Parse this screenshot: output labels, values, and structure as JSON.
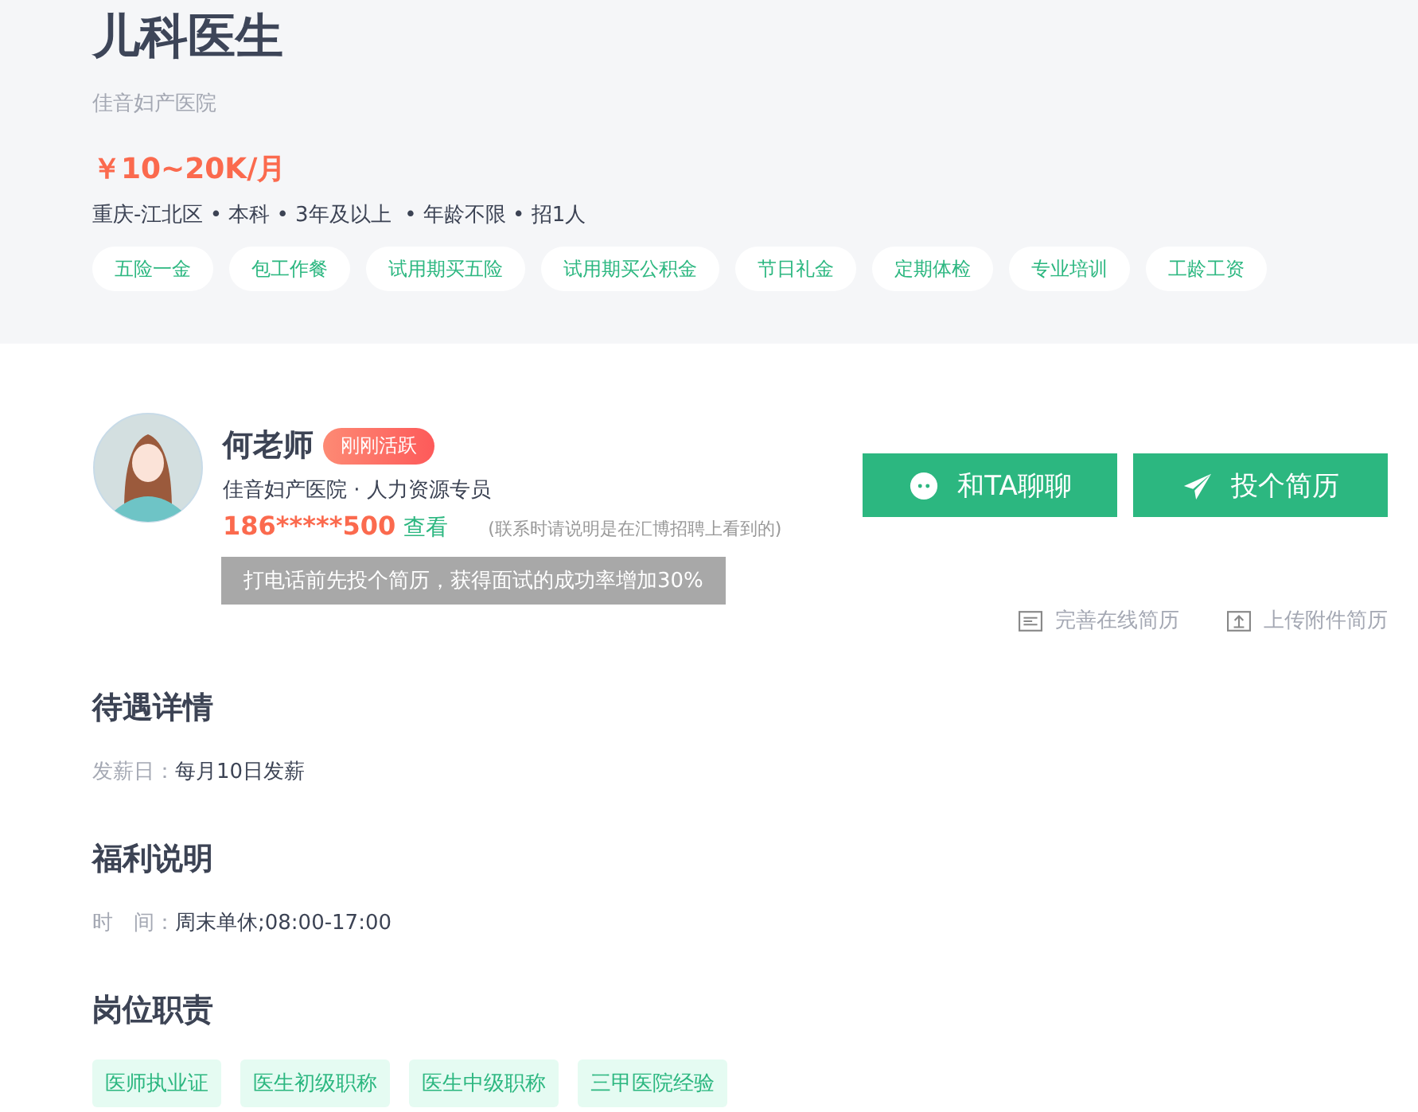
{
  "job": {
    "title": "儿科医生",
    "company": "佳音妇产医院",
    "salary": "￥10~20K/月",
    "meta": "重庆-江北区 • 本科 • 3年及以上  • 年龄不限 • 招1人",
    "benefits": [
      "五险一金",
      "包工作餐",
      "试用期买五险",
      "试用期买公积金",
      "节日礼金",
      "定期体检",
      "专业培训",
      "工龄工资"
    ]
  },
  "recruiter": {
    "name": "何老师",
    "status": "刚刚活跃",
    "org": "佳音妇产医院 · 人力资源专员",
    "phone": "186*****500",
    "view_link": "查看",
    "note": "(联系时请说明是在汇博招聘上看到的)",
    "tooltip": "打电话前先投个简历，获得面试的成功率增加30%"
  },
  "actions": {
    "chat": "和TA聊聊",
    "apply": "投个简历",
    "links": [
      {
        "kind": "online",
        "label": "完善在线简历"
      },
      {
        "kind": "upload",
        "label": "上传附件简历"
      }
    ]
  },
  "sections": [
    {
      "title": "待遇详情",
      "rows": [
        {
          "label": "发薪日：",
          "value": "每月10日发薪"
        }
      ]
    },
    {
      "title": "福利说明",
      "rows": [
        {
          "label": "时　间：",
          "value": "周末单休;08:00-17:00"
        }
      ]
    },
    {
      "title": "岗位职责",
      "tags": [
        "医师执业证",
        "医生初级职称",
        "医生中级职称",
        "三甲医院经验"
      ]
    }
  ]
}
